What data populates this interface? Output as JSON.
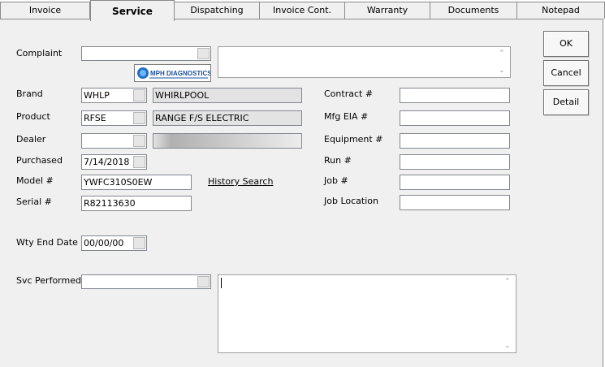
{
  "tabs": [
    "Invoice",
    "Service",
    "Dispatching",
    "Invoice Cont.",
    "Warranty",
    "Documents",
    "Notepad"
  ],
  "active_tab": "Service",
  "buttons": {
    "ok": "OK",
    "cancel": "Cancel",
    "detail": "Detail"
  },
  "logo": {
    "text": "MPH DIAGNOSTICS",
    "mark": "M"
  },
  "labels": {
    "complaint": "Complaint",
    "brand": "Brand",
    "product": "Product",
    "dealer": "Dealer",
    "purchased": "Purchased",
    "model": "Model #",
    "serial": "Serial #",
    "wty_end_date": "Wty End Date",
    "svc_performed": "Svc Performed",
    "contract": "Contract #",
    "mfg_eia": "Mfg EIA #",
    "equipment": "Equipment #",
    "run": "Run #",
    "job": "Job #",
    "job_location": "Job Location"
  },
  "values": {
    "complaint_code": "",
    "complaint_text": "",
    "brand_code": "WHLP",
    "brand_name": "WHIRLPOOL",
    "product_code": "RFSE",
    "product_name": "RANGE F/S ELECTRIC",
    "dealer_code": "",
    "dealer_name": "",
    "purchased": "7/14/2018",
    "model": "YWFC310S0EW",
    "serial": "R82113630",
    "wty_end_date": "00/00/00",
    "svc_performed_code": "",
    "svc_performed_text": "",
    "contract": "",
    "mfg_eia": "",
    "equipment": "",
    "run": "",
    "job": "",
    "job_location": ""
  },
  "links": {
    "history_search": "History Search"
  }
}
